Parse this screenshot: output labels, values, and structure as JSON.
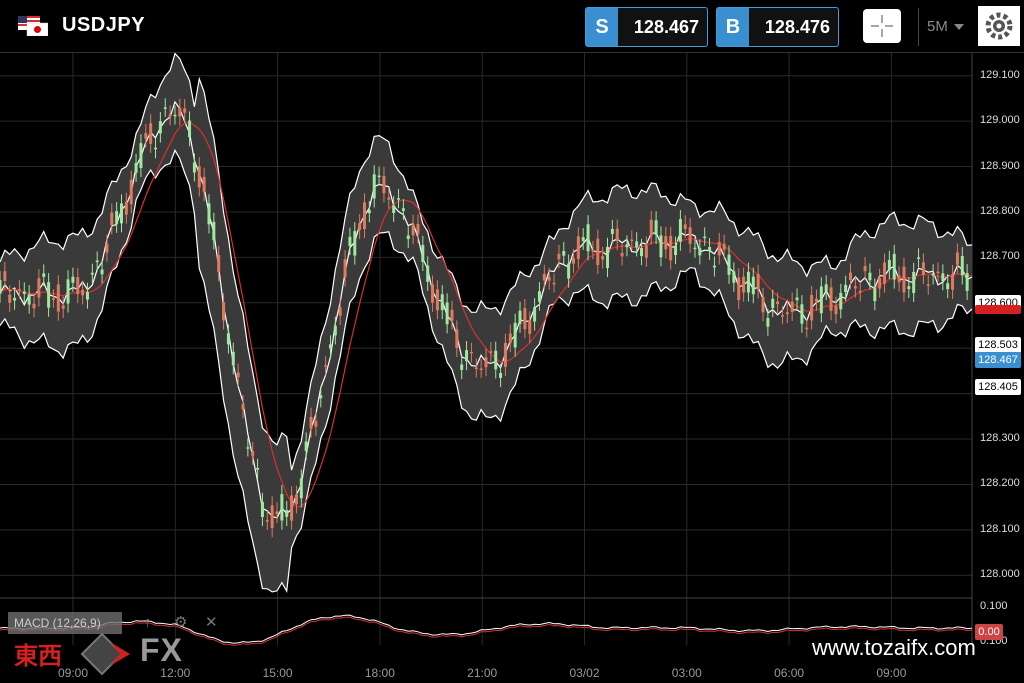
{
  "header": {
    "symbol": "USDJPY",
    "sell": {
      "tag": "S",
      "price": "128.467"
    },
    "buy": {
      "tag": "B",
      "price": "128.476"
    },
    "timeframe": "5M",
    "icons": {
      "flag": "us-jp-flag-icon",
      "crosshair": "crosshair-icon",
      "settings": "gear-icon",
      "dropdown": "caret-down-icon"
    }
  },
  "price_axis": {
    "ticks": [
      "129.100",
      "129.000",
      "128.900",
      "128.800",
      "128.700",
      "128.600",
      "128.503",
      "128.467",
      "128.405",
      "128.300",
      "128.200",
      "128.100",
      "128.000"
    ]
  },
  "macd": {
    "label": "MACD (12,26,9)",
    "axis": [
      "0.100",
      "0.100"
    ],
    "current": "0.00",
    "icons": [
      "arrow-icon",
      "gear-icon",
      "close-icon"
    ]
  },
  "markers": {
    "sell_price": "128.467",
    "upper_level": "128.600",
    "mid_level": "128.503",
    "lower_level": "128.405"
  },
  "time_axis": [
    "09:00",
    "12:00",
    "15:00",
    "18:00",
    "21:00",
    "03/02",
    "03:00",
    "06:00",
    "09:00"
  ],
  "watermark": {
    "jp": "東西",
    "fx": "FX",
    "url": "www.tozaifx.com"
  },
  "colors": {
    "up": "#9fe89f",
    "down": "#e07a5f",
    "band": "#ffffff",
    "ma": "#d93030",
    "sell": "#3a8fd0"
  },
  "chart_data": {
    "type": "line",
    "title": "USDJPY",
    "ylim": [
      127.95,
      129.15
    ],
    "x": [
      "09:00",
      "12:00",
      "15:00",
      "18:00",
      "21:00",
      "03/02",
      "03:00",
      "06:00",
      "09:00"
    ],
    "series": [
      {
        "values": [
          128.62,
          129.02,
          128.12,
          128.85,
          128.46,
          128.72,
          128.74,
          128.58,
          128.66
        ]
      }
    ]
  }
}
